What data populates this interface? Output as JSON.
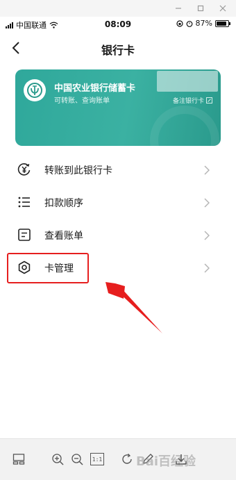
{
  "status_bar": {
    "carrier": "中国联通",
    "time": "08:09",
    "battery": "87%"
  },
  "nav": {
    "title": "银行卡"
  },
  "card": {
    "bank_name": "中国农业银行储蓄卡",
    "subtitle": "可转账、查询账单",
    "remark_label": "备注银行卡"
  },
  "menu": {
    "items": [
      {
        "label": "转账到此银行卡",
        "icon": "transfer-yen-icon"
      },
      {
        "label": "扣款顺序",
        "icon": "list-icon"
      },
      {
        "label": "查看账单",
        "icon": "bill-icon"
      },
      {
        "label": "卡管理",
        "icon": "gear-icon"
      }
    ]
  },
  "toolbar": {
    "icons": [
      "layout-icon",
      "zoom-in-icon",
      "zoom-out-icon",
      "actual-size-icon",
      "rotate-icon",
      "edit-icon",
      "download-icon"
    ],
    "actual_size_label": "1:1",
    "watermark_text": "Bai百经验"
  },
  "colors": {
    "card_accent": "#2fa89b",
    "highlight": "#e61e1e"
  }
}
